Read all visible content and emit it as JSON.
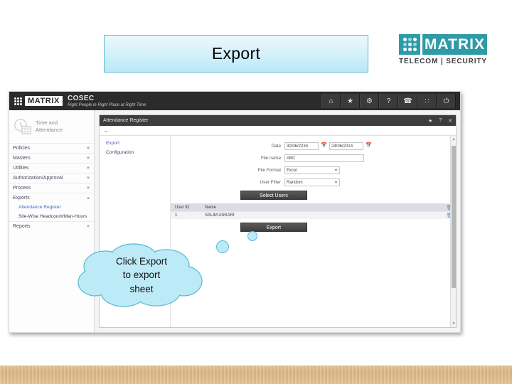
{
  "slide": {
    "title": "Export"
  },
  "brand": {
    "name": "MATRIX",
    "tagline": "TELECOM | SECURITY",
    "logo_icon": "matrix-dot-grid-icon",
    "color": "#2e9ba6"
  },
  "app": {
    "topbar": {
      "logo_text": "MATRIX",
      "product": "COSEC",
      "product_tagline": "Right People in Right Place at Right Time",
      "icons": [
        {
          "name": "home-icon",
          "glyph": "⌂"
        },
        {
          "name": "star-icon",
          "glyph": "★"
        },
        {
          "name": "gear-icon",
          "glyph": "⚙"
        },
        {
          "name": "help-icon",
          "glyph": "?"
        },
        {
          "name": "phone-icon",
          "glyph": "☎"
        },
        {
          "name": "apps-grid-icon",
          "glyph": "∷"
        },
        {
          "name": "power-icon",
          "glyph": "⏻"
        }
      ]
    },
    "sidebar": {
      "module_title_line1": "Time and",
      "module_title_line2": "Attendance",
      "module_icon": "clock-calendar-icon",
      "items": [
        {
          "label": "Policies",
          "expanded": false
        },
        {
          "label": "Masters",
          "expanded": false
        },
        {
          "label": "Utilities",
          "expanded": false
        },
        {
          "label": "Authorization/Approval",
          "expanded": false
        },
        {
          "label": "Process",
          "expanded": false
        },
        {
          "label": "Exports",
          "expanded": true
        },
        {
          "label": "Reports",
          "expanded": false
        }
      ],
      "sub_items": [
        {
          "label": "Attendance Register",
          "selected": true
        },
        {
          "label": "Site-Wise Headcount/Man-Hours",
          "selected": false
        }
      ]
    },
    "window": {
      "title": "Attendance Register",
      "title_icons": [
        {
          "name": "favorite-star-icon",
          "glyph": "★"
        },
        {
          "name": "help-icon",
          "glyph": "?"
        },
        {
          "name": "close-icon",
          "glyph": "✕"
        }
      ],
      "back_icon": "back-arrow-icon",
      "section_nav": [
        {
          "label": "Export",
          "selected": true
        },
        {
          "label": "Configuration",
          "selected": false
        }
      ],
      "form": {
        "date_label": "Date",
        "date_from": "30/06/2234",
        "date_to": "24/06/2014",
        "calendar_icon": "calendar-icon",
        "file_name_label": "File name",
        "file_name_value": "ABC",
        "file_format_label": "File Format",
        "file_format_value": "Excel",
        "user_filter_label": "User Filter",
        "user_filter_value": "Random",
        "dropdown_icon": "chevron-down-icon",
        "select_users_button": "Select Users",
        "export_button": "Export"
      },
      "table": {
        "columns": [
          "User ID",
          "Name"
        ],
        "delete_icon": "trash-icon",
        "rows": [
          {
            "user_id": "1",
            "name": "SALIM ANSARI"
          }
        ]
      },
      "scrollbar": {
        "up_arrow": "▲",
        "down_arrow": "▼"
      }
    }
  },
  "callout": {
    "line1": "Click Export",
    "line2": "to export",
    "line3": "sheet",
    "fill": "#bdeaf7",
    "stroke": "#56b9d4"
  }
}
